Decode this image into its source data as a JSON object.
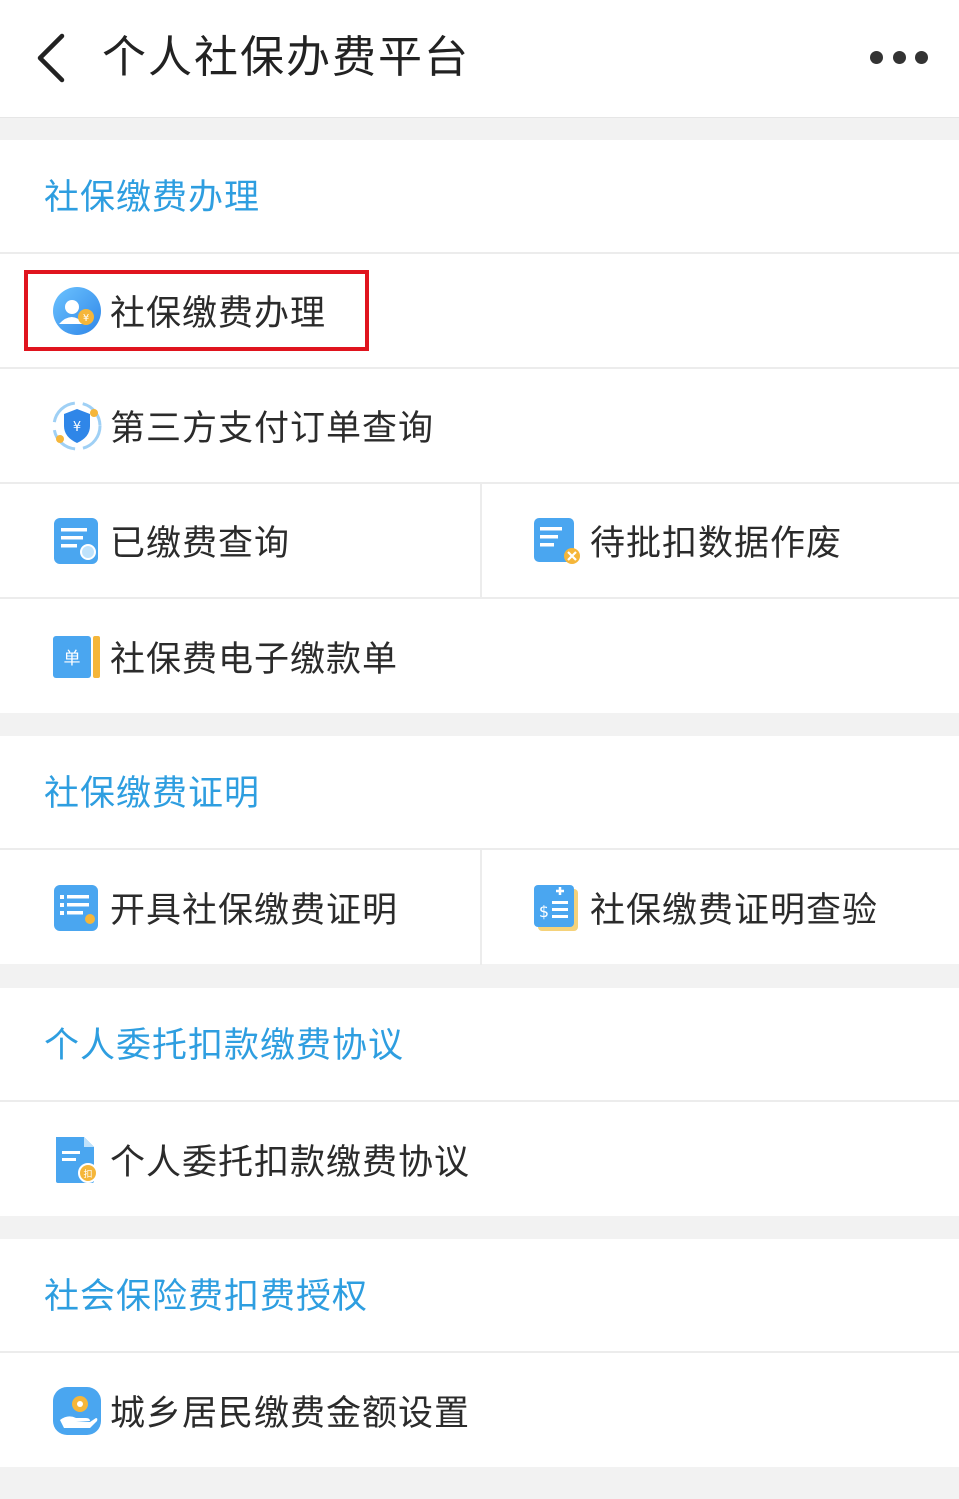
{
  "nav": {
    "title": "个人社保办费平台",
    "back_icon": "chevron-left-icon",
    "more_icon": "more-dots-icon"
  },
  "sections": [
    {
      "title": "社保缴费办理",
      "items": [
        {
          "label": "社保缴费办理",
          "icon": "user-yuan-icon",
          "highlighted": true
        },
        {
          "label": "第三方支付订单查询",
          "icon": "shield-yuan-icon"
        },
        {
          "label": "已缴费查询",
          "icon": "document-search-icon"
        },
        {
          "label": "待批扣数据作废",
          "icon": "document-cancel-icon"
        },
        {
          "label": "社保费电子缴款单",
          "icon": "receipt-book-icon"
        }
      ]
    },
    {
      "title": "社保缴费证明",
      "items": [
        {
          "label": "开具社保缴费证明",
          "icon": "certificate-list-icon"
        },
        {
          "label": "社保缴费证明查验",
          "icon": "certificate-verify-icon"
        }
      ]
    },
    {
      "title": "个人委托扣款缴费协议",
      "items": [
        {
          "label": "个人委托扣款缴费协议",
          "icon": "agreement-deduct-icon"
        }
      ]
    },
    {
      "title": "社会保险费扣费授权",
      "items": [
        {
          "label": "城乡居民缴费金额设置",
          "icon": "hand-gear-icon"
        }
      ]
    }
  ],
  "colors": {
    "accent": "#2e9ee0",
    "highlight_border": "#e0141e",
    "background": "#f2f2f2"
  }
}
